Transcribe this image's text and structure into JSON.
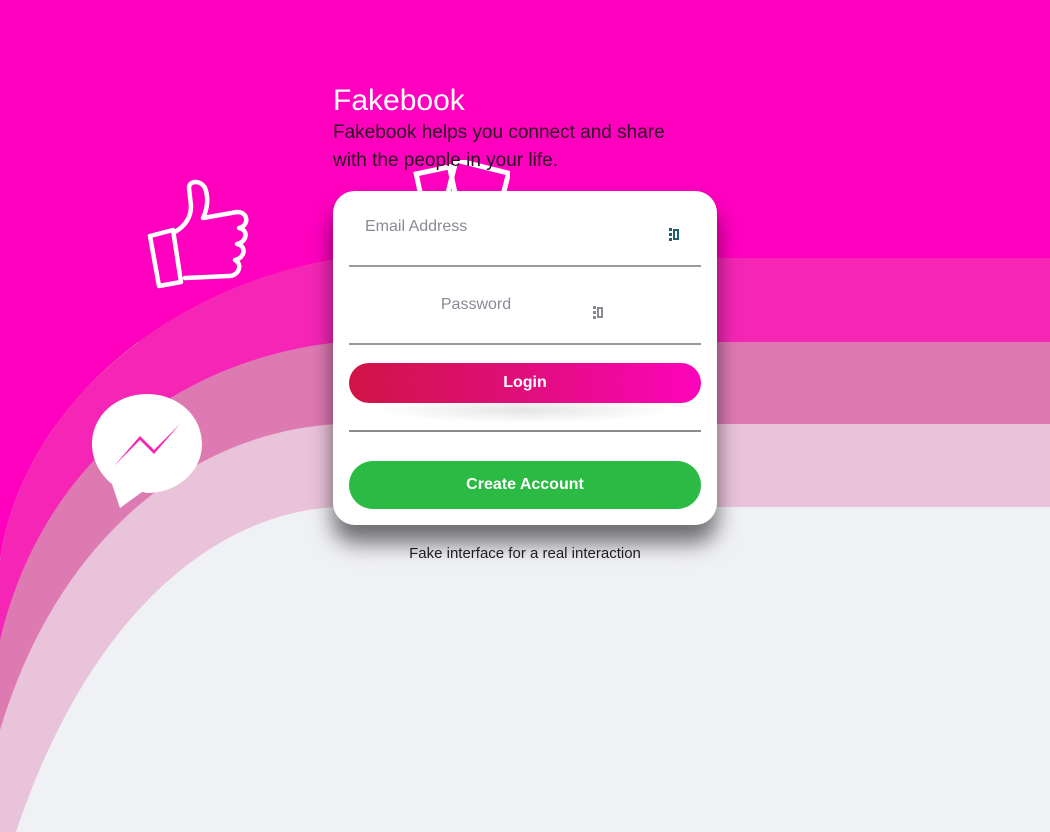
{
  "header": {
    "brand": "Fakebook",
    "tagline": "Fakebook helps you connect and share with the people in your life."
  },
  "login_form": {
    "email_placeholder": "Email Address",
    "email_value": "",
    "password_placeholder": "Password",
    "password_value": "",
    "login_label": "Login",
    "create_account_label": "Create Account"
  },
  "footer": {
    "note": "Fake interface for a real interaction"
  },
  "icons": {
    "thumb": "thumbs-up-icon",
    "messenger": "messenger-icon",
    "photos": "photos-icon",
    "password_manager": "password-manager-key-icon"
  },
  "colors": {
    "background_top": "#ff00bf",
    "band_1": "#f526b6",
    "band_2": "#de7ab2",
    "band_3": "#e9c3da",
    "page_background": "#f0f1f5",
    "login_gradient_start": "#d01445",
    "login_gradient_end": "#fd04bb",
    "create_account": "#2bba44"
  }
}
